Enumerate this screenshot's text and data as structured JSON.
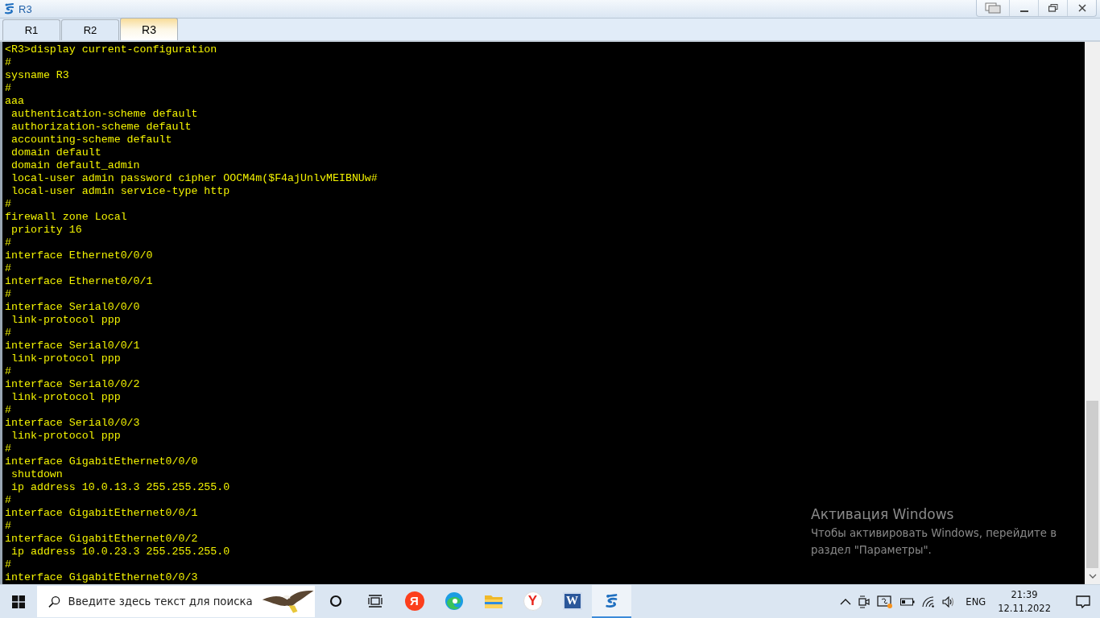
{
  "window": {
    "title": "R3"
  },
  "tabs": [
    {
      "label": "R1",
      "selected": false
    },
    {
      "label": "R2",
      "selected": false
    },
    {
      "label": "R3",
      "selected": true
    }
  ],
  "terminal": {
    "lines": [
      "<R3>display current-configuration",
      "#",
      "sysname R3",
      "#",
      "aaa",
      " authentication-scheme default",
      " authorization-scheme default",
      " accounting-scheme default",
      " domain default",
      " domain default_admin",
      " local-user admin password cipher OOCM4m($F4ajUnlvMEIBNUw#",
      " local-user admin service-type http",
      "#",
      "firewall zone Local",
      " priority 16",
      "#",
      "interface Ethernet0/0/0",
      "#",
      "interface Ethernet0/0/1",
      "#",
      "interface Serial0/0/0",
      " link-protocol ppp",
      "#",
      "interface Serial0/0/1",
      " link-protocol ppp",
      "#",
      "interface Serial0/0/2",
      " link-protocol ppp",
      "#",
      "interface Serial0/0/3",
      " link-protocol ppp",
      "#",
      "interface GigabitEthernet0/0/0",
      " shutdown",
      " ip address 10.0.13.3 255.255.255.0",
      "#",
      "interface GigabitEthernet0/0/1",
      "#",
      "interface GigabitEthernet0/0/2",
      " ip address 10.0.23.3 255.255.255.0",
      "#",
      "interface GigabitEthernet0/0/3"
    ]
  },
  "activation": {
    "title": "Активация Windows",
    "text": "Чтобы активировать Windows, перейдите в раздел \"Параметры\"."
  },
  "taskbar": {
    "search": {
      "placeholder": "Введите здесь текст для поиска"
    },
    "apps": [
      {
        "kind": "cortana",
        "active": false
      },
      {
        "kind": "task-view",
        "active": false
      },
      {
        "kind": "yandex",
        "glyph": "Я",
        "active": false
      },
      {
        "kind": "edge",
        "active": false
      },
      {
        "kind": "explorer",
        "active": false
      },
      {
        "kind": "yandex-browser",
        "glyph": "Y",
        "active": false
      },
      {
        "kind": "word",
        "glyph": "W",
        "active": false
      },
      {
        "kind": "ensp",
        "active": true
      }
    ],
    "language": "ENG",
    "time": "21:39",
    "date": "12.11.2022"
  }
}
